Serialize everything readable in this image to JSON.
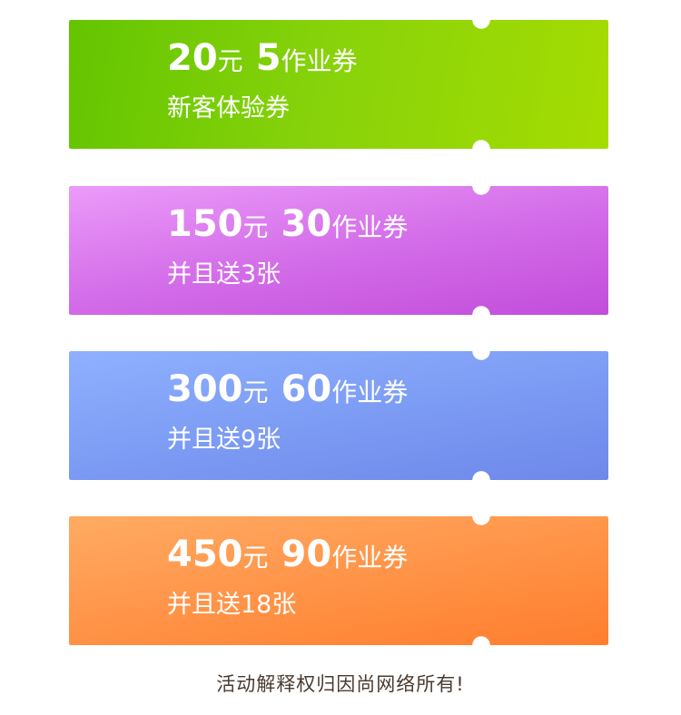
{
  "coupons": [
    {
      "price": "20",
      "price_unit": "元",
      "count": "5",
      "count_unit": "作业券",
      "subtitle": "新客体验券"
    },
    {
      "price": "150",
      "price_unit": "元",
      "count": "30",
      "count_unit": "作业券",
      "subtitle": "并且送3张"
    },
    {
      "price": "300",
      "price_unit": "元",
      "count": "60",
      "count_unit": "作业券",
      "subtitle": "并且送9张"
    },
    {
      "price": "450",
      "price_unit": "元",
      "count": "90",
      "count_unit": "作业券",
      "subtitle": "并且送18张"
    }
  ],
  "footer": "活动解释权归因尚网络所有!",
  "colors": {
    "coupon_1": "#86d20a",
    "coupon_2": "#d46ee9",
    "coupon_3": "#7d9cf4",
    "coupon_4": "#ff9448",
    "footer_text": "#4a3b30"
  }
}
